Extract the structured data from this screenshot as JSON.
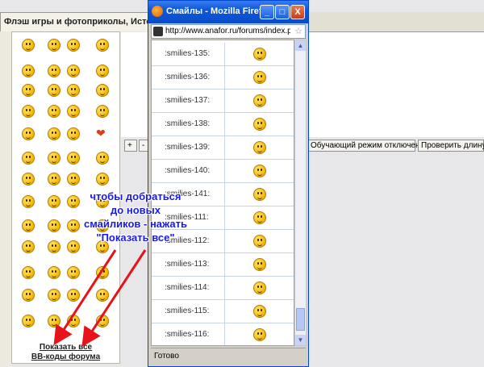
{
  "background_tab": {
    "title": "Флэш игры и фотоприколы, Истори..."
  },
  "sidebar": {
    "show_all": "Показать все",
    "bbcodes": "BB-коды форума"
  },
  "toolbar": {
    "plus": "+",
    "minus": "-",
    "training_mode": "Обучающий режим отключен",
    "check_length": "Проверить длину"
  },
  "popup": {
    "title": "Смайлы - Mozilla Firefox",
    "minimize": "_",
    "maximize": "□",
    "close": "X",
    "url": "http://www.anafor.ru/forums/index.p",
    "status": "Готово",
    "rows": [
      {
        "code": ":smilies-135:"
      },
      {
        "code": ":smilies-136:"
      },
      {
        "code": ":smilies-137:"
      },
      {
        "code": ":smilies-138:"
      },
      {
        "code": ":smilies-139:"
      },
      {
        "code": ":smilies-140:"
      },
      {
        "code": ":smilies-141:"
      },
      {
        "code": ":smilies-111:"
      },
      {
        "code": ":smilies-112:"
      },
      {
        "code": ":smilies-113:"
      },
      {
        "code": ":smilies-114:"
      },
      {
        "code": ":smilies-115:"
      },
      {
        "code": ":smilies-116:"
      }
    ]
  },
  "annotation": {
    "line1": "чтобы добраться",
    "line2": "до новых",
    "line3": "смайликов - нажать",
    "line4": "\"Показать все\""
  },
  "colors": {
    "arrow": "#e8121a",
    "annotation": "#1a1ae6",
    "titlebar": "#0c58d8"
  }
}
